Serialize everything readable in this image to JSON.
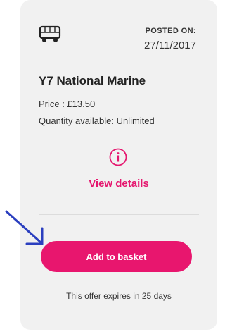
{
  "card": {
    "posted_label": "POSTED ON:",
    "posted_date": "27/11/2017",
    "title": "Y7 National Marine",
    "price": "Price : £13.50",
    "quantity": "Quantity available: Unlimited",
    "view_details": "View details",
    "add_to_basket": "Add to basket",
    "expires": "This offer expires in 25 days"
  },
  "icons": {
    "transport": "bus-icon",
    "info": "info-icon",
    "annotation": "arrow-icon"
  },
  "colors": {
    "accent": "#e8166e",
    "card_bg": "#f1f1f1",
    "arrow": "#2b3fbf"
  }
}
